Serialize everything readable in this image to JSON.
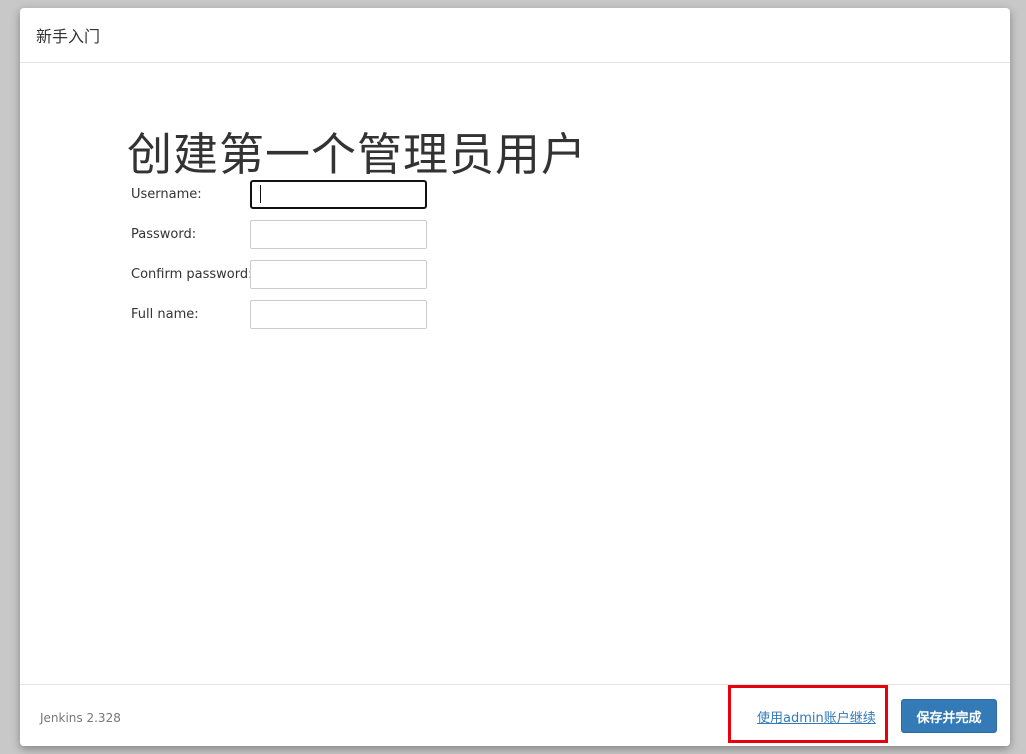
{
  "dialog": {
    "title": "新手入门"
  },
  "main": {
    "heading": "创建第一个管理员用户",
    "form": {
      "fields": [
        {
          "label": "Username:",
          "value": ""
        },
        {
          "label": "Password:",
          "value": ""
        },
        {
          "label": "Confirm password:",
          "value": ""
        },
        {
          "label": "Full name:",
          "value": ""
        }
      ]
    }
  },
  "footer": {
    "version": "Jenkins 2.328",
    "admin_link": "使用admin账户继续",
    "save_button": "保存并完成"
  },
  "colors": {
    "primary": "#337ab7",
    "highlight": "#e8000c",
    "backdrop": "#c8c8c8"
  }
}
